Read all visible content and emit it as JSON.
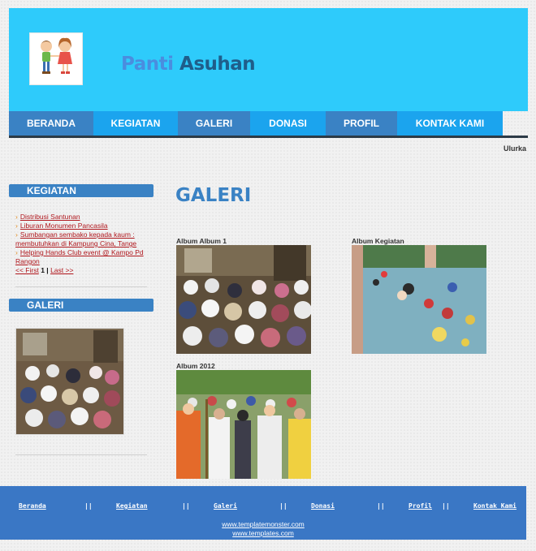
{
  "header": {
    "title_part1": "Panti",
    "title_part2": "Asuhan"
  },
  "nav": {
    "items": [
      {
        "label": "BERANDA"
      },
      {
        "label": "KEGIATAN"
      },
      {
        "label": "GALERI"
      },
      {
        "label": "DONASI"
      },
      {
        "label": "PROFIL"
      },
      {
        "label": "KONTAK KAMI"
      }
    ]
  },
  "marquee_text": "Ulurka",
  "sidebar": {
    "kegiatan_heading": "KEGIATAN",
    "kegiatan_items": [
      {
        "label": "Distribusi Santunan"
      },
      {
        "label": "Liburan Monumen Pancasila"
      },
      {
        "label": "Sumbangan sembako kepada kaum : membutuhkan di Kampung Cina, Tange"
      },
      {
        "label": "Helping Hands Club event @ Kampo Pd Rangon"
      }
    ],
    "pager": {
      "first": "<< First",
      "current": "1",
      "separator": "|",
      "last": "Last >>"
    },
    "galeri_heading": "GALERI"
  },
  "main": {
    "title": "GALERI",
    "albums": [
      {
        "label": "Album Album 1"
      },
      {
        "label": "Album Kegiatan"
      },
      {
        "label": "Album 2012"
      }
    ]
  },
  "footer": {
    "links": [
      {
        "label": "Beranda"
      },
      {
        "label": "Kegiatan"
      },
      {
        "label": "Galeri"
      },
      {
        "label": "Donasi"
      },
      {
        "label": "Profil"
      },
      {
        "label": "Kontak Kami"
      }
    ],
    "separator": "||",
    "credits": [
      "www.templatemonster.com",
      "www.templates.com"
    ]
  },
  "colors": {
    "header_bg": "#2ecbfb",
    "nav_dark": "#3a82c4",
    "nav_light": "#1ba4ee",
    "link_red": "#b0171d",
    "footer_bg": "#3a77c5"
  }
}
